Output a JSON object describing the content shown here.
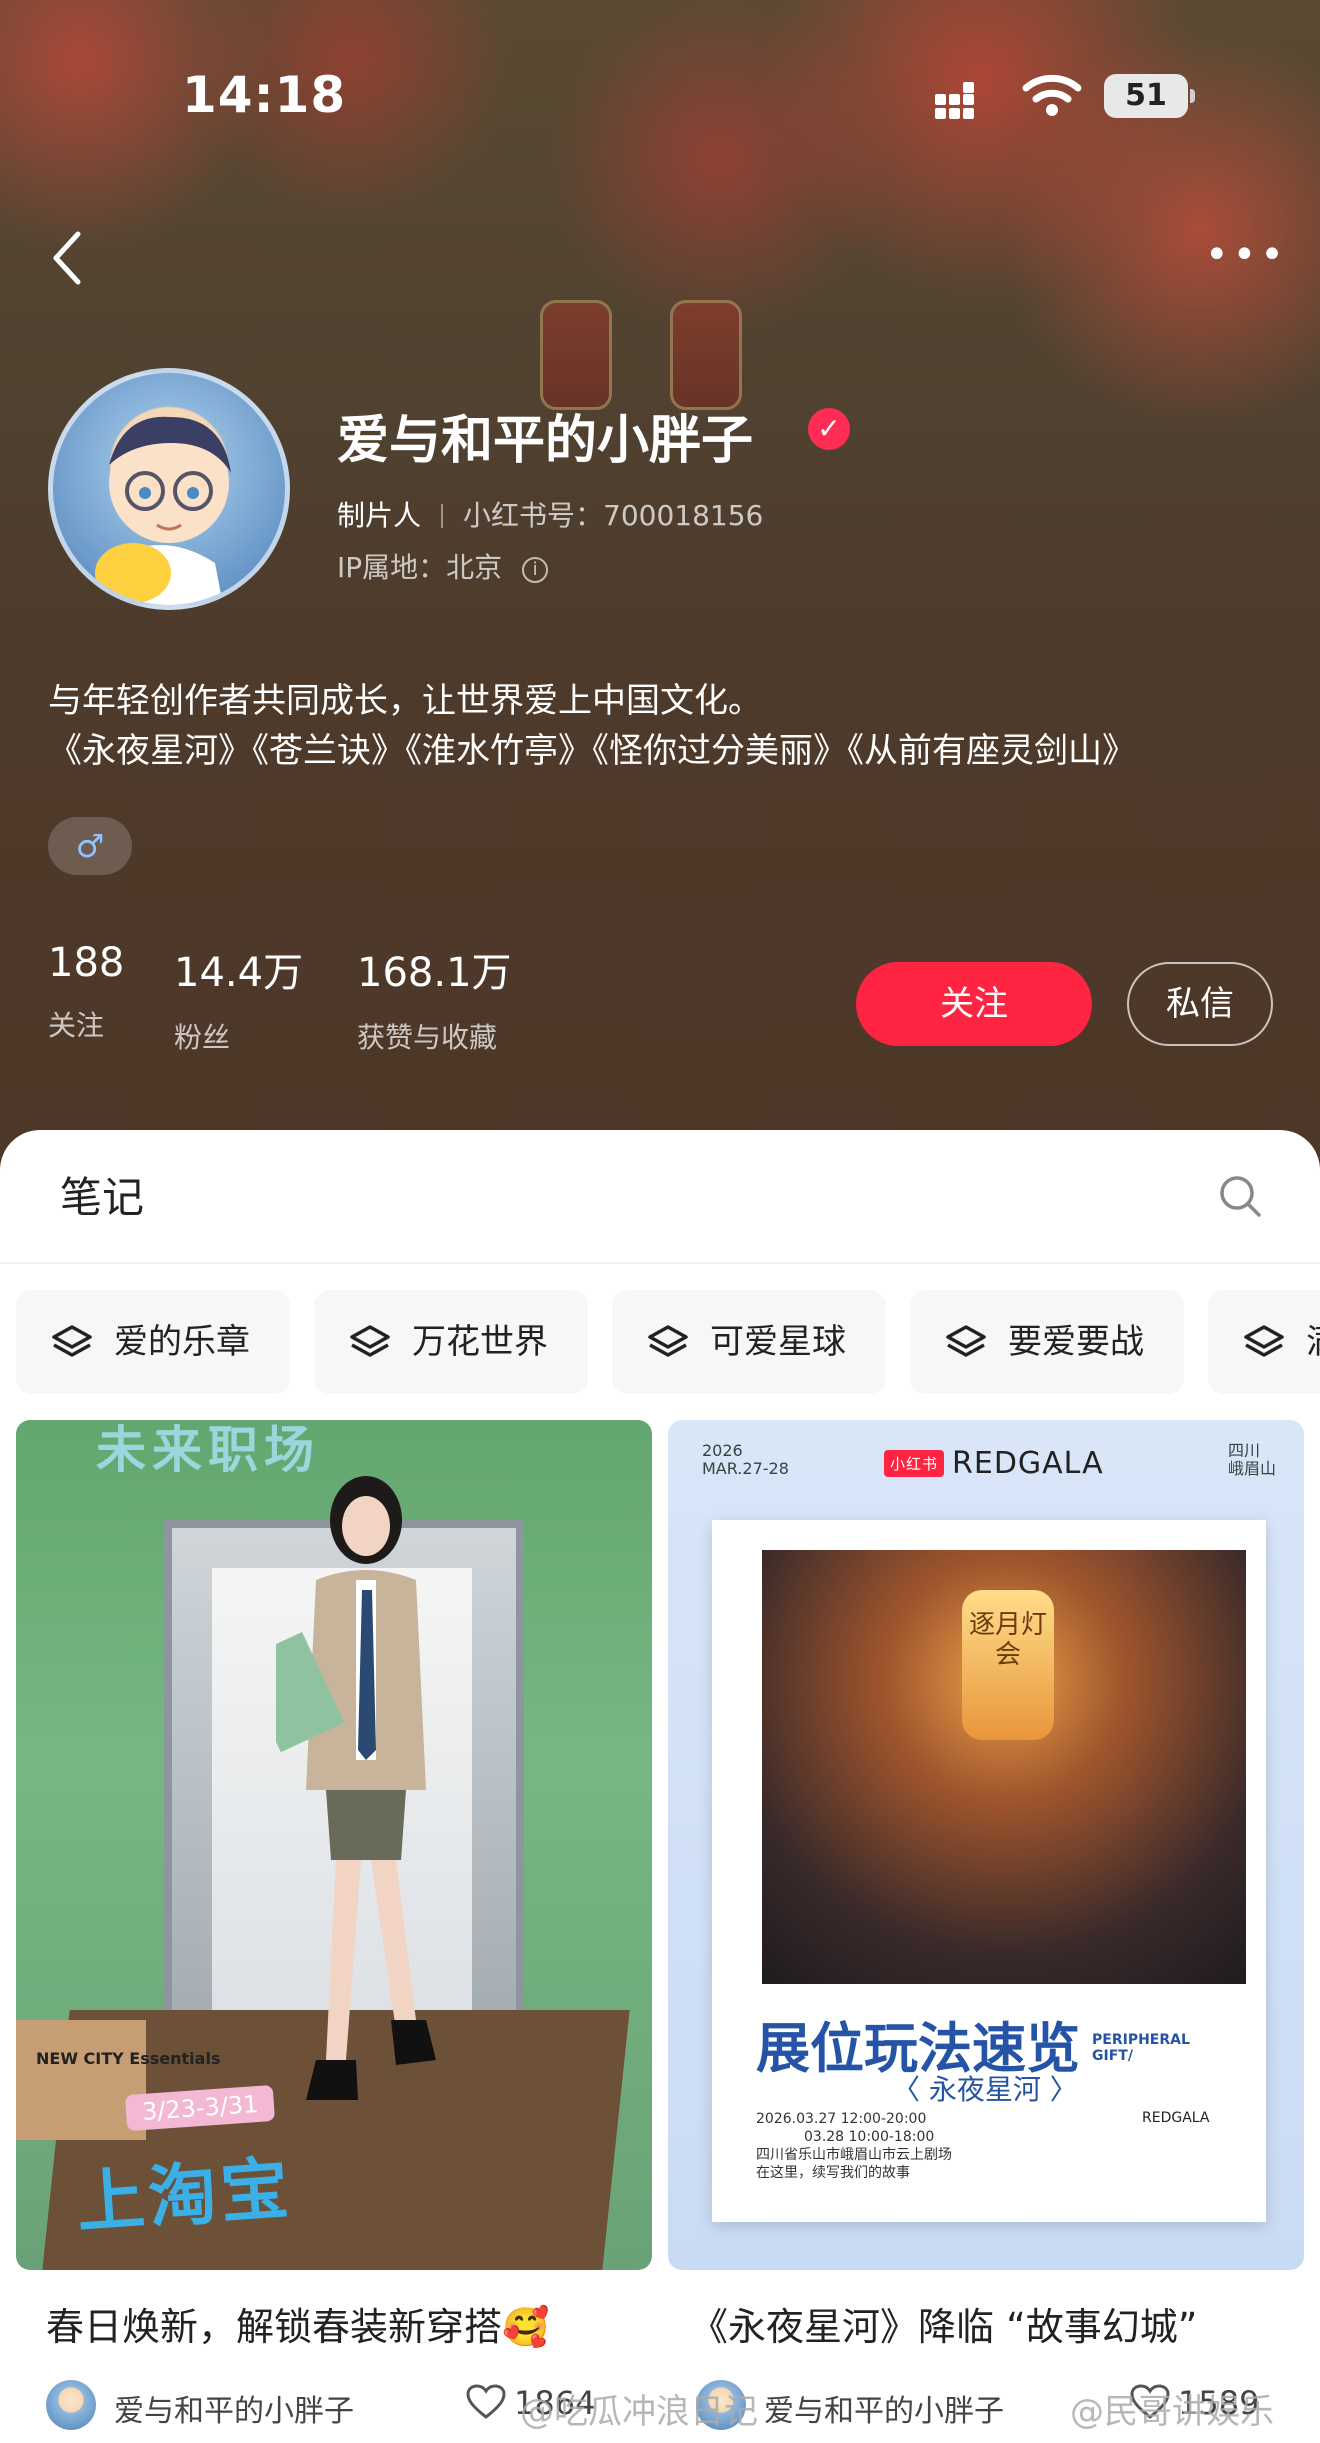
{
  "status_bar": {
    "time": "14:18",
    "battery": "51"
  },
  "profile": {
    "name": "爱与和平的小胖子",
    "role": "制片人",
    "red_id": "小红书号：700018156",
    "ip": "IP属地：北京",
    "bio_line1": "与年轻创作者共同成长，让世界爱上中国文化。",
    "bio_line2": "《永夜星河》《苍兰诀》《淮水竹亭》《怪你过分美丽》《从前有座灵剑山》",
    "gender_icon": "male-icon",
    "stats": [
      {
        "value": "188",
        "label": "关注"
      },
      {
        "value": "14.4万",
        "label": "粉丝"
      },
      {
        "value": "168.1万",
        "label": "获赞与收藏"
      }
    ],
    "follow_label": "关注",
    "message_label": "私信"
  },
  "tabs": {
    "notes_label": "笔记"
  },
  "collections": [
    "爱的乐章",
    "万花世界",
    "可爱星球",
    "要爱要战",
    "满"
  ],
  "posts": [
    {
      "title": "春日焕新，解锁春装新穿搭🥰",
      "author": "爱与和平的小胖子",
      "likes": "1864",
      "poster_main": "上淘宝",
      "poster_top": "未来职场",
      "poster_dates": "3/23-3/31",
      "box_text": "NEW CITY Essentials"
    },
    {
      "title": "《永夜星河》降临 “故事幻城”",
      "author": "爱与和平的小胖子",
      "likes": "1589",
      "poster_date": "2026 MAR.27-28",
      "poster_brand": "REDGALA",
      "poster_brand_badge": "小红书",
      "poster_place": "四川 峨眉山",
      "poster_lantern": "逐月灯会",
      "poster_title": "展位玩法速览",
      "poster_subtitle": "PERIPHERAL GIFT/",
      "poster_series": "〈 永夜星河 〉",
      "poster_info1": "2026.03.27 12:00-20:00",
      "poster_info2": "03.28 10:00-18:00",
      "poster_info3": "四川省乐山市峨眉山市云上剧场",
      "poster_info4": "在这里，续写我们的故事",
      "poster_small": "REDGALA"
    }
  ],
  "watermarks": [
    "@吃瓜冲浪日记",
    "@民哥讲娱乐"
  ],
  "colors": {
    "accent": "#ff2442",
    "header_bg": "#4e3a2a"
  }
}
